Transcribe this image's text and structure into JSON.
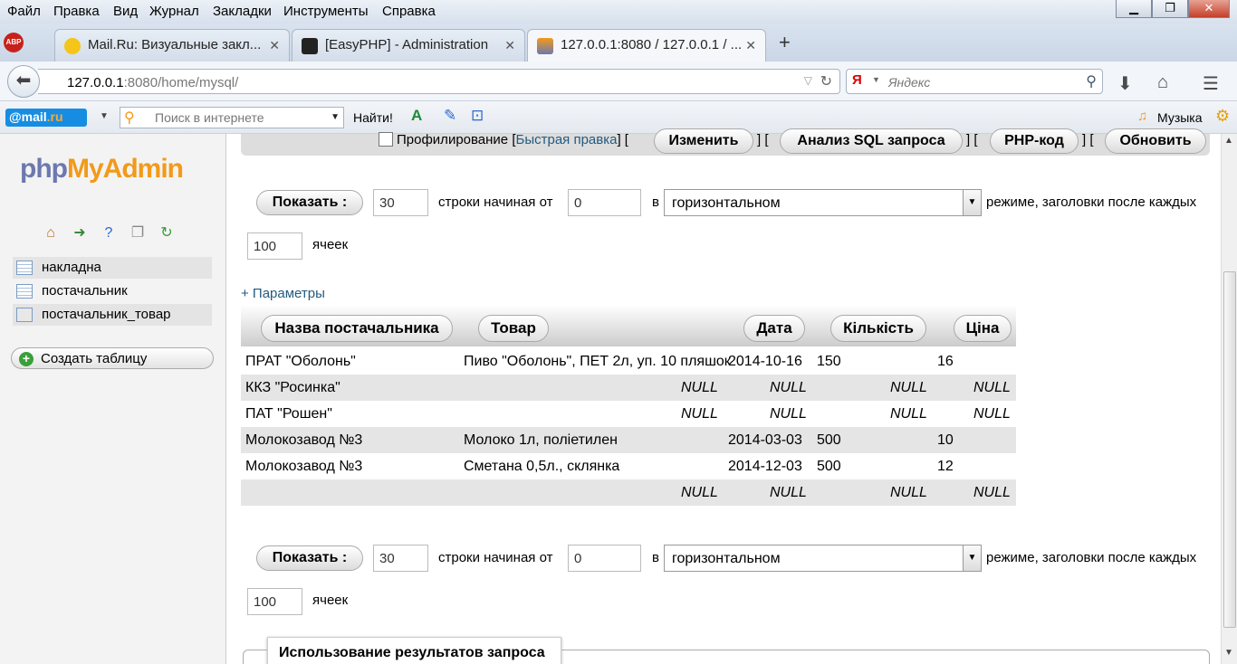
{
  "menu": [
    "Файл",
    "Правка",
    "Вид",
    "Журнал",
    "Закладки",
    "Инструменты",
    "Справка"
  ],
  "window_controls": {
    "min": "▁",
    "max": "❐",
    "close": "✕"
  },
  "tabs": [
    {
      "label": "Mail.Ru: Визуальные закл...",
      "close": "✕"
    },
    {
      "label": "[EasyPHP] - Administration",
      "close": "✕"
    },
    {
      "label": "127.0.0.1:8080 / 127.0.0.1 / ...",
      "close": "✕"
    }
  ],
  "new_tab": "+",
  "abp": "ABP",
  "url": {
    "host": "127.0.0.1",
    "rest": ":8080/home/mysql/"
  },
  "search_placeholder": "Яндекс",
  "mail_bar": {
    "logo_at": "@mail",
    "logo_ru": ".ru",
    "search_placeholder": "Поиск в интернете",
    "find": "Найти!",
    "music": "Музыка"
  },
  "logo": {
    "php": "php",
    "myadmin": "MyAdmin"
  },
  "tables": [
    {
      "name": "накладна"
    },
    {
      "name": "постачальник"
    },
    {
      "name": "постачальник_товар"
    }
  ],
  "create_table": "Создать таблицу",
  "toolbar": {
    "profiling": "Профилирование [",
    "quick_edit": "Быстрая правка",
    "bracket_close": "] [",
    "edit": "Изменить",
    "analyze": "Анализ SQL запроса",
    "php_code": "PHP-код",
    "refresh": "Обновить"
  },
  "nav": {
    "show": "Показать :",
    "rows": "30",
    "rows_label": "строки начиная от",
    "start": "0",
    "in": "в",
    "mode": "горизонтальном",
    "mode_label": "режиме, заголовки после каждых",
    "repeat": "100",
    "cells": "ячеек"
  },
  "params_link": "+ Параметры",
  "columns": [
    "Назва постачальника",
    "Товар",
    "Дата",
    "Кількість",
    "Ціна"
  ],
  "rows": [
    [
      "ПРАТ \"Оболонь\"",
      "Пиво \"Оболонь\", ПЕТ 2л, уп. 10 пляшок",
      "2014-10-16",
      "150",
      "16"
    ],
    [
      "ККЗ \"Росинка\"",
      "NULL",
      "NULL",
      "NULL",
      "NULL"
    ],
    [
      "ПАТ \"Рошен\"",
      "NULL",
      "NULL",
      "NULL",
      "NULL"
    ],
    [
      "Молокозавод №3",
      "Молоко 1л, поліетилен",
      "2014-03-03",
      "500",
      "10"
    ],
    [
      "Молокозавод №3",
      "Сметана 0,5л., склянка",
      "2014-12-03",
      "500",
      "12"
    ],
    [
      "",
      "NULL",
      "NULL",
      "NULL",
      "NULL"
    ]
  ],
  "query_results": "Использование результатов запроса"
}
